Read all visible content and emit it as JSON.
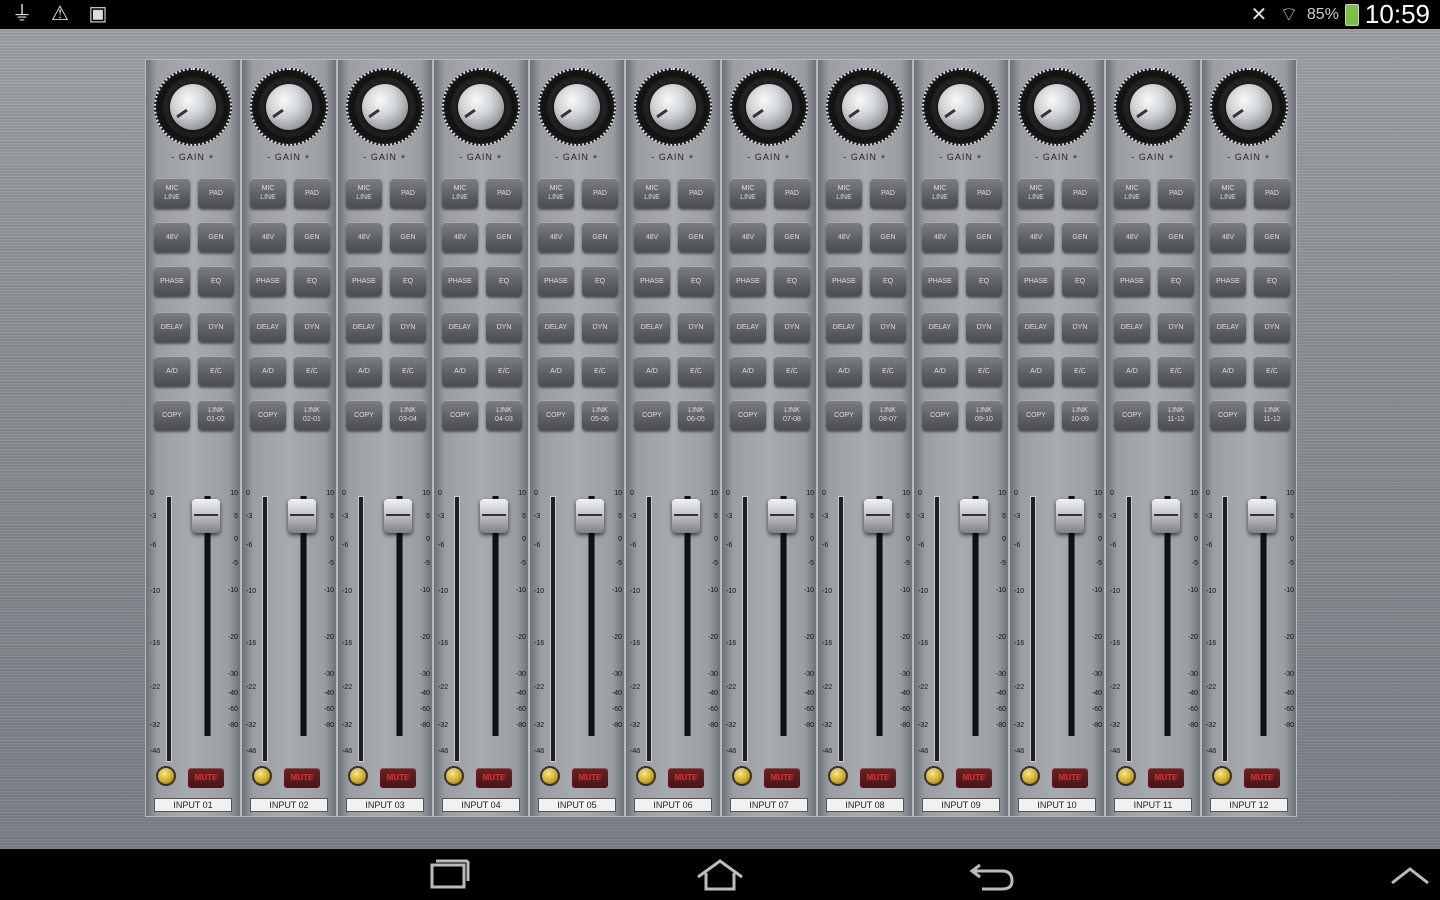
{
  "status_bar": {
    "left_icons": [
      "usb-icon",
      "warning-icon",
      "image-icon"
    ],
    "battery_percent": "85%",
    "time": "10:59"
  },
  "mixer": {
    "gain_label": "- GAIN +",
    "channels": [
      {
        "name": "INPUT 01",
        "link": "LINK\n01-02",
        "fader": 0.96
      },
      {
        "name": "INPUT 02",
        "link": "LINK\n02-01",
        "fader": 0.96
      },
      {
        "name": "INPUT 03",
        "link": "LINK\n03-04",
        "fader": 0.96
      },
      {
        "name": "INPUT 04",
        "link": "LINK\n04-03",
        "fader": 0.96
      },
      {
        "name": "INPUT 05",
        "link": "LINK\n05-06",
        "fader": 0.96
      },
      {
        "name": "INPUT 06",
        "link": "LINK\n06-05",
        "fader": 0.96
      },
      {
        "name": "INPUT 07",
        "link": "LINK\n07-08",
        "fader": 0.96
      },
      {
        "name": "INPUT 08",
        "link": "LINK\n08-07",
        "fader": 0.96
      },
      {
        "name": "INPUT 09",
        "link": "LINK\n09-10",
        "fader": 0.96
      },
      {
        "name": "INPUT 10",
        "link": "LINK\n10-09",
        "fader": 0.96
      },
      {
        "name": "INPUT 11",
        "link": "LINK\n11-12",
        "fader": 0.96
      },
      {
        "name": "INPUT 12",
        "link": "LINK\n11-12",
        "fader": 0.96
      }
    ],
    "buttons": {
      "mic_line": "MIC\nLINE",
      "pad": "PAD",
      "phantom": "48V",
      "gen": "GEN",
      "phase": "PHASE",
      "eq": "EQ",
      "delay": "DELAY",
      "dyn": "DYN",
      "ad": "A/D",
      "ec": "E/C",
      "copy": "COPY"
    },
    "mute_label": "MUTE",
    "meter_scale": [
      "0",
      "-3",
      "-6",
      "-10",
      "-16",
      "-22",
      "-32",
      "-48"
    ],
    "fader_scale": [
      "10",
      "5",
      "0",
      "-5",
      "-10",
      "-20",
      "-30",
      "-40",
      "-60",
      "-80"
    ]
  },
  "nav_bar": {
    "icons": [
      "recent-apps-icon",
      "home-icon",
      "back-icon",
      "chevron-up-icon"
    ]
  }
}
